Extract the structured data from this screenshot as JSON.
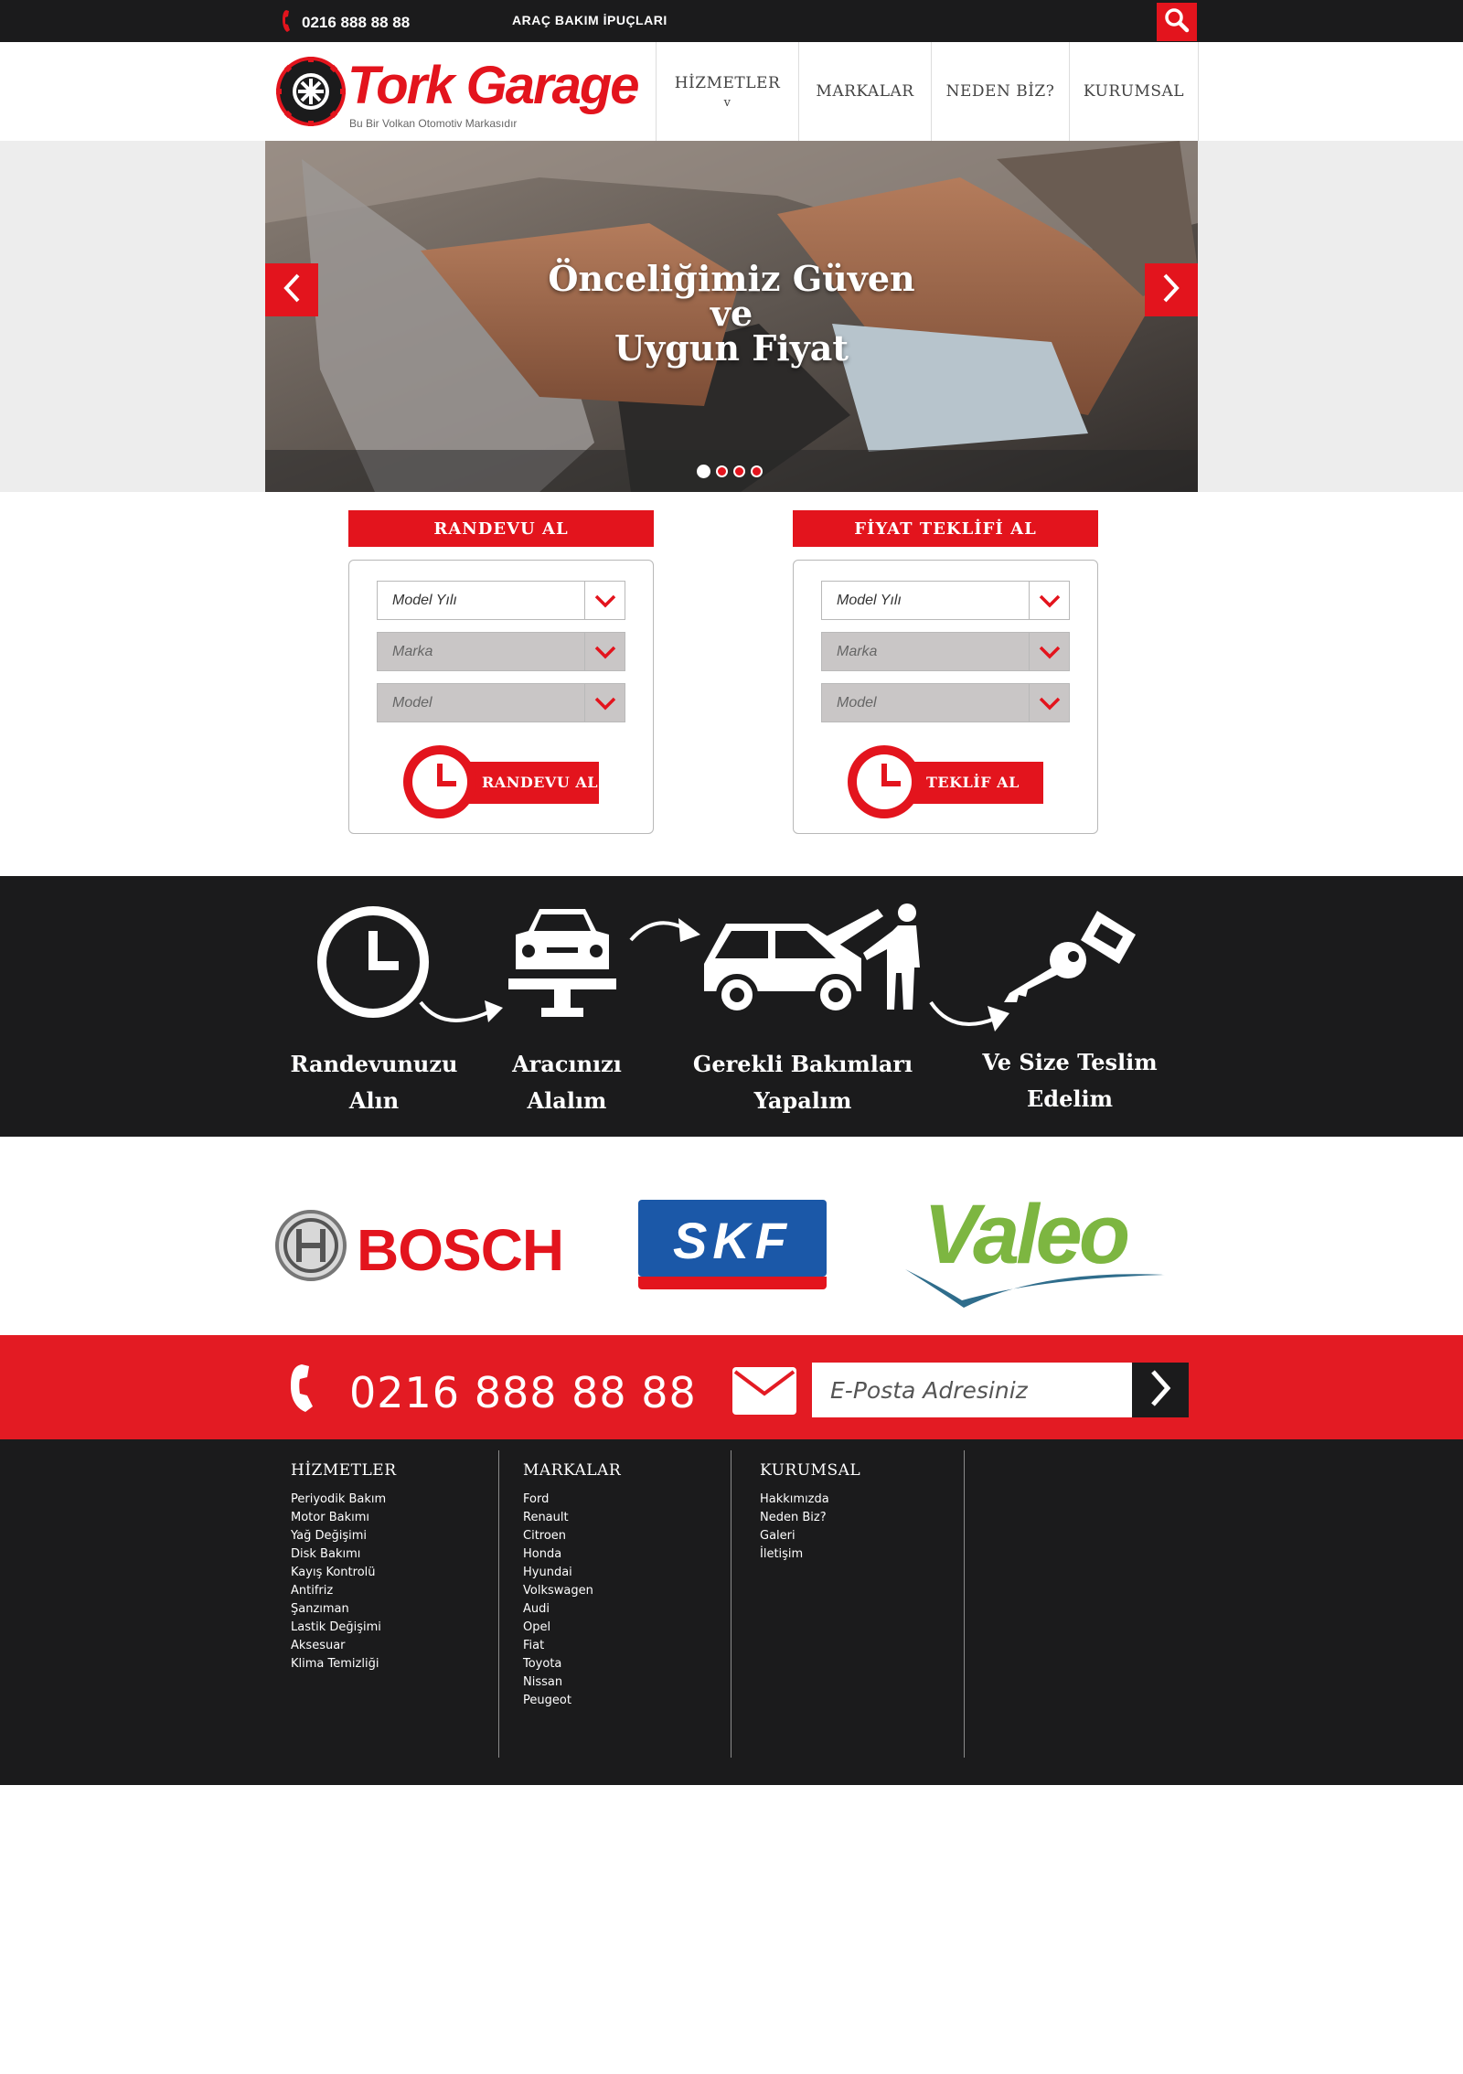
{
  "topbar": {
    "phone": "0216 888 88 88",
    "tips_link": "ARAÇ BAKIM İPUÇLARI",
    "icons": {
      "phone": "phone-icon",
      "search": "search-icon"
    }
  },
  "header": {
    "brand": "Tork Garage",
    "tagline": "Bu Bir Volkan Otomotiv Markasıdır",
    "nav": [
      {
        "label": "HİZMETLER",
        "caret": "v"
      },
      {
        "label": "MARKALAR"
      },
      {
        "label": "NEDEN BİZ?"
      },
      {
        "label": "KURUMSAL"
      }
    ]
  },
  "slider": {
    "headline": [
      "Önceliğimiz Güven",
      "ve",
      "Uygun Fiyat"
    ],
    "slide_count": 4,
    "active_slide": 1
  },
  "appointment_form": {
    "title": "RANDEVU AL",
    "selects": [
      {
        "value": "Model Yılı",
        "enabled": true
      },
      {
        "value": "Marka",
        "enabled": false
      },
      {
        "value": "Model",
        "enabled": false
      }
    ],
    "button": "RANDEVU AL"
  },
  "quote_form": {
    "title": "FİYAT TEKLİFİ AL",
    "selects": [
      {
        "value": "Model Yılı",
        "enabled": true
      },
      {
        "value": "Marka",
        "enabled": false
      },
      {
        "value": "Model",
        "enabled": false
      }
    ],
    "button": "TEKLİF AL"
  },
  "steps": [
    {
      "label_1": "Randevunuzu",
      "label_2": "Alın",
      "icon": "clock-icon"
    },
    {
      "label_1": "Aracınızı",
      "label_2": "Alalım",
      "icon": "car-lift-icon"
    },
    {
      "label_1": "Gerekli Bakımları",
      "label_2": "Yapalım",
      "icon": "mechanic-icon"
    },
    {
      "label_1": "Ve Size Teslim",
      "label_2": "Edelim",
      "icon": "car-key-icon"
    }
  ],
  "partners": [
    "BOSCH",
    "SKF",
    "Valeo"
  ],
  "contact": {
    "phone": "0216 888 88 88",
    "email_placeholder": "E-Posta Adresiniz"
  },
  "footer": {
    "columns": [
      {
        "title": "HİZMETLER",
        "items": [
          "Periyodik Bakım",
          "Motor Bakımı",
          "Yağ Değişimi",
          "Disk Bakımı",
          "Kayış Kontrolü",
          "Antifriz",
          "Şanzıman",
          "Lastik Değişimi",
          "Aksesuar",
          "Klima Temizliği"
        ]
      },
      {
        "title": "MARKALAR",
        "items": [
          "Ford",
          "Renault",
          "Citroen",
          "Honda",
          "Hyundai",
          "Volkswagen",
          "Audi",
          "Opel",
          "Fiat",
          "Toyota",
          "Nissan",
          "Peugeot"
        ]
      },
      {
        "title": "KURUMSAL",
        "items": [
          "Hakkımızda",
          "Neden Biz?",
          "Galeri",
          "İletişim"
        ]
      }
    ]
  },
  "colors": {
    "accent": "#e3141d",
    "dark": "#1b1b1c",
    "contact_bar": "#e31b23"
  }
}
